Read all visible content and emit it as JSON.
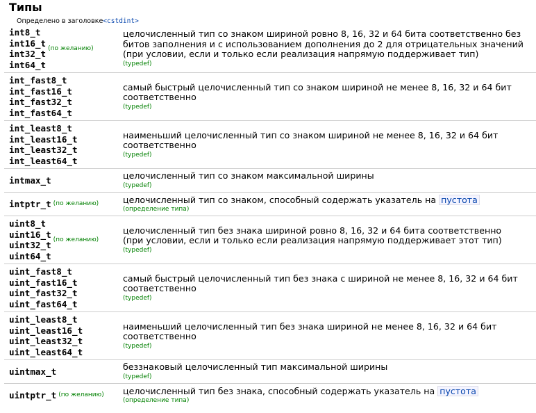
{
  "title": "Типы",
  "defined_prefix": "Определено в заголовке",
  "defined_header": "<cstdint>",
  "rows": [
    {
      "names": [
        "int8_t",
        "int16_t",
        "int32_t",
        "int64_t"
      ],
      "optional": "(по желанию)",
      "desc": "целочисленный тип со знаком шириной ровно 8, 16, 32 и 64 бита соответственно без битов заполнения и с использованием дополнения до 2 для отрицательных значений",
      "desc2": "(при условии, если и только если реализация напрямую поддерживает тип)",
      "mark": "(typedef)"
    },
    {
      "names": [
        "int_fast8_t",
        "int_fast16_t",
        "int_fast32_t",
        "int_fast64_t"
      ],
      "optional": "",
      "desc": "самый быстрый целочисленный тип со знаком шириной не менее 8, 16, 32 и 64 бит соответственно",
      "desc2": "",
      "mark": "(typedef)"
    },
    {
      "names": [
        "int_least8_t",
        "int_least16_t",
        "int_least32_t",
        "int_least64_t"
      ],
      "optional": "",
      "desc": "наименьший целочисленный тип со знаком шириной не менее 8, 16, 32 и 64 бит соответственно",
      "desc2": "",
      "mark": "(typedef)"
    },
    {
      "names": [
        "intmax_t"
      ],
      "optional": "",
      "desc": "целочисленный тип со знаком максимальной ширины",
      "desc2": "",
      "mark": "(typedef)"
    },
    {
      "names": [
        "intptr_t"
      ],
      "optional": "(по желанию)",
      "desc": "целочисленный тип со знаком, способный содержать указатель на",
      "keyword": "пустота",
      "desc2": "",
      "mark": "(определение типа)"
    },
    {
      "names": [
        "uint8_t",
        "uint16_t",
        "uint32_t",
        "uint64_t"
      ],
      "optional": "(по желанию)",
      "desc": "целочисленный тип без знака шириной ровно 8, 16, 32 и 64 бита соответственно",
      "desc2": "(при условии, если и только если реализация напрямую поддерживает этот тип)",
      "mark": "(typedef)"
    },
    {
      "names": [
        "uint_fast8_t",
        "uint_fast16_t",
        "uint_fast32_t",
        "uint_fast64_t"
      ],
      "optional": "",
      "desc": "самый быстрый целочисленный тип без знака с шириной не менее 8, 16, 32 и 64 бит соответственно",
      "desc2": "",
      "mark": "(typedef)"
    },
    {
      "names": [
        "uint_least8_t",
        "uint_least16_t",
        "uint_least32_t",
        "uint_least64_t"
      ],
      "optional": "",
      "desc": "наименьший целочисленный тип без знака шириной не менее 8, 16, 32 и 64 бит соответственно",
      "desc2": "",
      "mark": "(typedef)"
    },
    {
      "names": [
        "uintmax_t"
      ],
      "optional": "",
      "desc": "беззнаковый целочисленный тип максимальной ширины",
      "desc2": "",
      "mark": "(typedef)"
    },
    {
      "names": [
        "uintptr_t"
      ],
      "optional": "(по желанию)",
      "desc": "целочисленный тип без знака, способный содержать указатель на",
      "keyword": "пустота",
      "desc2": "",
      "mark": "(определение типа)"
    }
  ]
}
